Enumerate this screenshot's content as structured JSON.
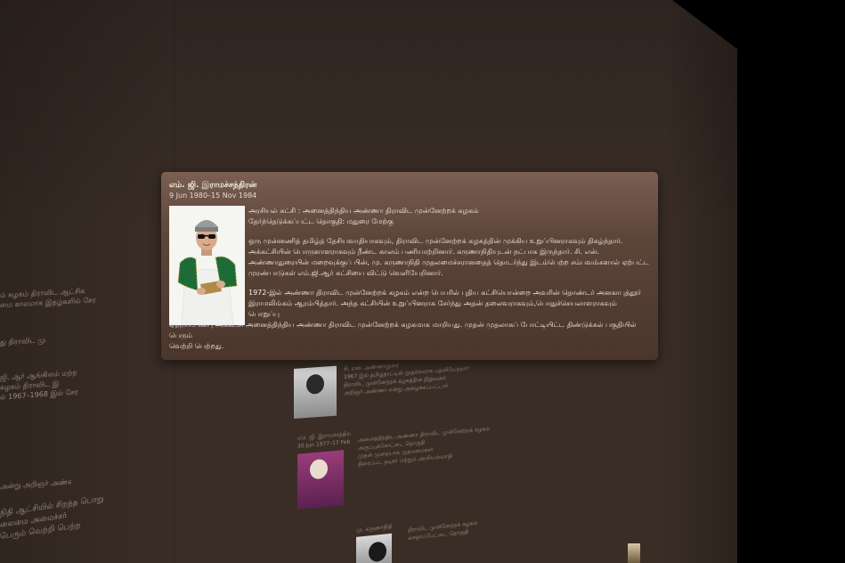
{
  "popup": {
    "title": "எம். ஜி. இராமச்சந்திரன்",
    "dates": "9 Jun 1980–15 Nov 1984",
    "party_line": "அரசியல் கட்சி : அனைத்திந்திய அண்ணா திராவிட முன்னேற்றக் கழகம்",
    "constituency_line": "தேர்ந்தெடுக்கப்பட்ட தொகுதி: மதுரை மேற்கு",
    "para1": [
      "ஒரு முன்னணித் தமிழ்த் தேசியவாதியாகவும், திராவிட முன்னேற்றக் கழகத்தின் முக்கிய உறுப்பினராகவும் திகழ்ந்தார்.",
      "அக்கட்சியின் பொருளாளராகவும் நீண்ட காலம் பணியாற்றினார். கருணாநிதியுடன் நட்பாக இருந்தார். சி. என்.",
      "அண்ணாதுரையின் மறைவுக்குப் பின், மு. கருணாநிதி முதலமைச்சரானதைத் தொடர்ந்து இடம்பெற்ற சம்பவங்களால் ஏற்பட்ட",
      "முரண்பாடுகள் எம்.ஜி.ஆர் கட்சியை விட்டு வெளியேறினார்."
    ],
    "para2_first": "1972-இல் அண்ணா திராவிட முன்னேற்றக் கழகம் என்ற பெயரில் புதிய கட்சியொன்றை அவரின் தொண்டர் அனகாபுத்தூர்",
    "para2_rest": [
      "இராமலிங்கம் ஆரம்பித்தார். அந்த கட்சியின் உறுப்பினராக சேர்ந்து அதன் தலைவராகவும்,பொதுச்செயலாளராகவும் பொறுப்பு",
      "ஏற்றார்.பின்பு அக்கட்சி அனைத்திந்திய அண்ணா திராவிட முன்னேற்றக் கழகமாக மாறியது. முதன் முதலாகப் போட்டியிட்ட திண்டுக்கல் பகுதியில் பெரும்",
      "வெற்றி பெற்றது."
    ]
  },
  "background": {
    "left_fragments": [
      "ம் கழகம் திராவிட ஆட்சிக",
      "மை காலமாக இதழ்களில் சேர",
      "து திராவிட மு",
      "ஜி. ஆர் ஆங்கிலம் மற்ற",
      "கழகம் திராவிட இ",
      "ல் 1967–1968 இல் சேர",
      "அன்று அறிஞர் அண்ணா",
      "நிதி ஆட்சியில் சிறந்த பொறு",
      "லைமை அமைச்சர்",
      "பெரும் வெற்றி பெற்ற"
    ],
    "card1": {
      "title": "சி. என். அண்ணாதுரை",
      "lines": [
        "1967 இல் தமிழ்நாட்டின் முதல்வராக பதவியேற்றார்",
        "திராவிட முன்னேற்றக் கழகத்தின் நிறுவனர்",
        "அறிஞர் அண்ணா என்று அழைக்கப்பட்டார்"
      ]
    },
    "card2": {
      "title": "எம். ஜி. இராமச்சந்திரன்",
      "dates": "30 Jun 1977–17 Feb 1980",
      "lines": [
        "அனைத்திந்திய அண்ணா திராவிட முன்னேற்றக் கழகம்",
        "அருப்புக்கோட்டை தொகுதி",
        "முதன் முறையாக முதலமைச்சர்",
        "திரைப்பட நடிகர் மற்றும் அரசியல்வாதி"
      ]
    },
    "card3": {
      "title": "மு. கருணாநிதி",
      "lines": [
        "திராவிட முன்னேற்றக் கழகம்",
        "சைதாப்பேட்டை தொகுதி"
      ]
    }
  },
  "colors": {
    "wall": "#3a2d26",
    "popup_top": "#7a5f52",
    "popup_bottom": "#4a362c",
    "text": "#f4ece4"
  }
}
